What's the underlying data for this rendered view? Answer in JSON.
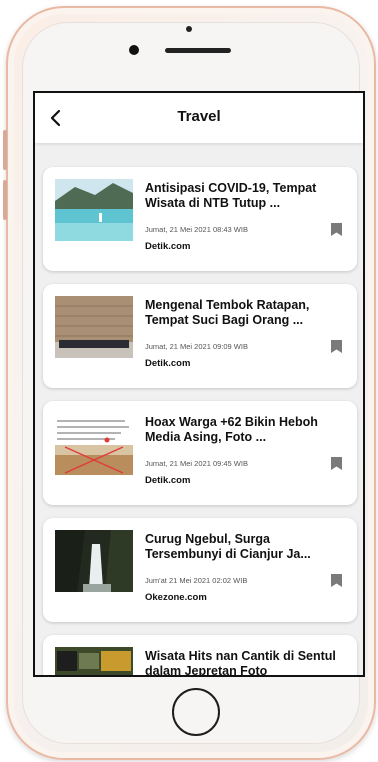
{
  "app": {
    "title": "Travel"
  },
  "articles": [
    {
      "title": "Antisipasi COVID-19, Tempat Wisata di NTB Tutup ...",
      "date": "Jumat, 21 Mei 2021 08:43 WIB",
      "source": "Detik.com",
      "thumb_icon": "beach-photo"
    },
    {
      "title": "Mengenal Tembok Ratapan, Tempat Suci Bagi Orang ...",
      "date": "Jumat, 21 Mei 2021 09:09 WIB",
      "source": "Detik.com",
      "thumb_icon": "wall-photo"
    },
    {
      "title": "Hoax Warga +62 Bikin Heboh Media Asing, Foto ...",
      "date": "Jumat, 21 Mei 2021 09:45 WIB",
      "source": "Detik.com",
      "thumb_icon": "hoax-photo"
    },
    {
      "title": "Curug Ngebul, Surga Tersembunyi di Cianjur Ja...",
      "date": "Jum'at 21 Mei 2021 02:02 WIB",
      "source": "Okezone.com",
      "thumb_icon": "waterfall-photo"
    },
    {
      "title": "Wisata Hits nan Cantik di Sentul dalam Jepretan Foto",
      "date": "",
      "source": "",
      "thumb_icon": "sign-photo"
    }
  ]
}
